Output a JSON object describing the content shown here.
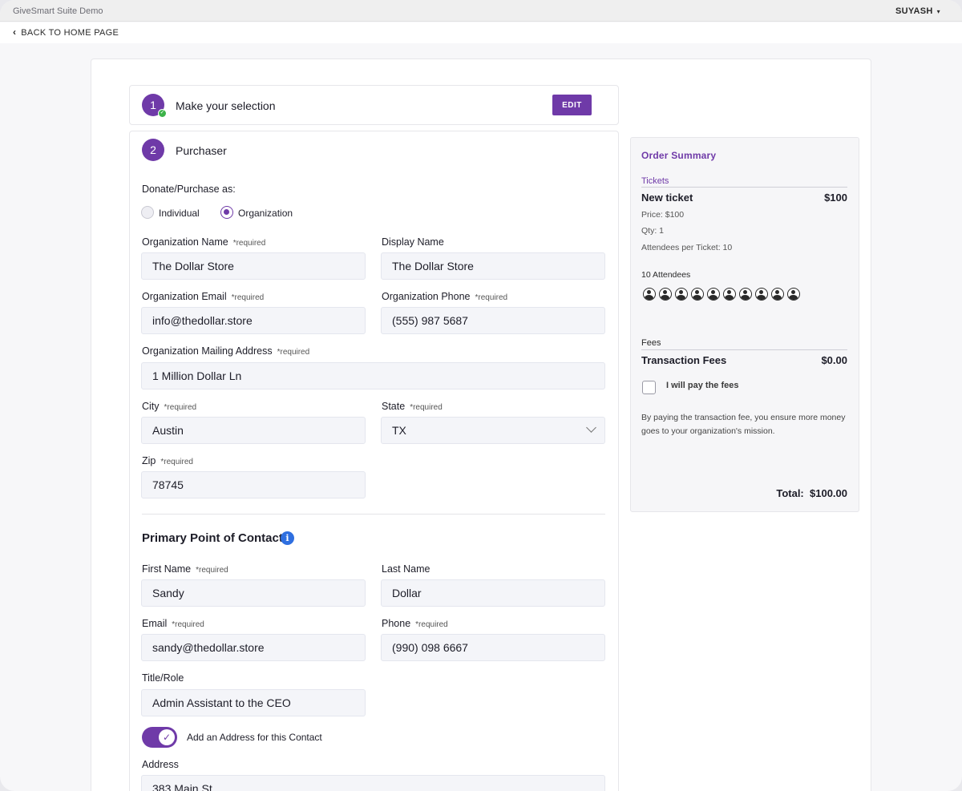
{
  "topbar": {
    "app_title": "GiveSmart Suite Demo",
    "user": "SUYASH",
    "user_caret": "▾"
  },
  "nav": {
    "back_label": "BACK TO HOME PAGE"
  },
  "step1": {
    "number": "1",
    "title": "Make your selection",
    "edit_label": "EDIT"
  },
  "step2": {
    "number": "2",
    "title": "Purchaser",
    "donate_as_label": "Donate/Purchase as:",
    "radio_individual": "Individual",
    "radio_organization": "Organization",
    "selected": "Organization"
  },
  "required_tag": "*required",
  "org": {
    "name_label": "Organization Name",
    "name_value": "The Dollar Store",
    "display_label": "Display Name",
    "display_value": "The Dollar Store",
    "email_label": "Organization Email",
    "email_value": "info@thedollar.store",
    "phone_label": "Organization Phone",
    "phone_value": "(555) 987 5687",
    "address_label": "Organization Mailing Address",
    "address_value": "1 Million Dollar Ln",
    "city_label": "City",
    "city_value": "Austin",
    "state_label": "State",
    "state_value": "TX",
    "zip_label": "Zip",
    "zip_value": "78745"
  },
  "contact": {
    "section_title": "Primary Point of Contact",
    "first_label": "First Name",
    "first_value": "Sandy",
    "last_label": "Last Name",
    "last_value": "Dollar",
    "email_label": "Email",
    "email_value": "sandy@thedollar.store",
    "phone_label": "Phone",
    "phone_value": "(990) 098 6667",
    "title_label": "Title/Role",
    "title_value": "Admin Assistant to the CEO",
    "toggle_label": "Add an Address for this Contact",
    "toggle_on": true,
    "address_label": "Address",
    "address_value": "383 Main St"
  },
  "summary": {
    "title": "Order Summary",
    "tickets_section": "Tickets",
    "ticket_name": "New ticket",
    "ticket_amount": "$100",
    "price_line": "Price: $100",
    "qty_line": "Qty: 1",
    "attendees_per_ticket": "Attendees per Ticket: 10",
    "attendees_count_label": "10 Attendees",
    "attendee_icon_count": 10,
    "fees_section": "Fees",
    "fee_name": "Transaction Fees",
    "fee_amount": "$0.00",
    "pay_fees_label": "I will pay the fees",
    "pay_fees_checked": false,
    "note": "By paying the transaction fee, you ensure more money goes to your organization's mission.",
    "total_label": "Total:",
    "total_amount": "$100.00"
  },
  "colors": {
    "accent": "#6f3aa8",
    "success": "#3db34a",
    "info": "#2f6fe0"
  }
}
